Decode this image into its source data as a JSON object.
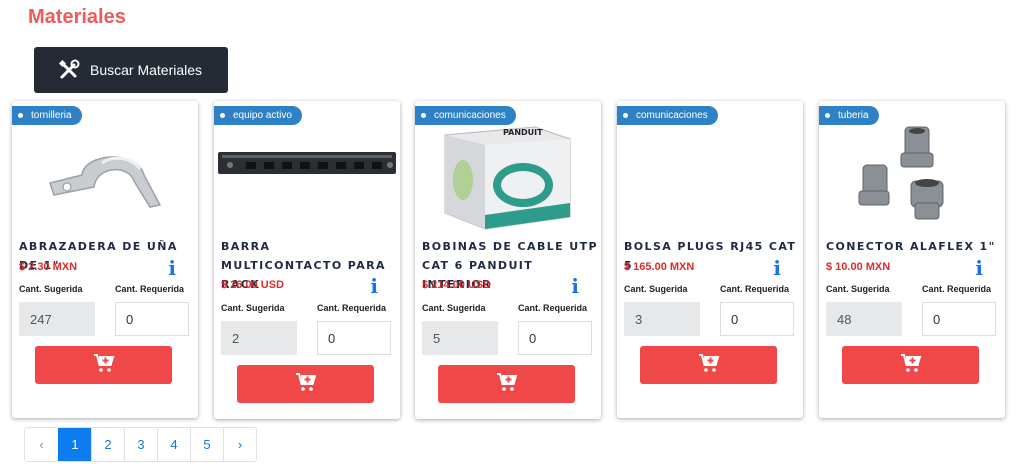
{
  "page": {
    "title": "Materiales"
  },
  "search": {
    "label": "Buscar Materiales"
  },
  "labels": {
    "suggested": "Cant. Sugerida",
    "required": "Cant. Requerida"
  },
  "products": [
    {
      "tag": "tornilleria",
      "name": "ABRAZADERA DE UÑA DE 1\"",
      "price": "$ 2.30 MXN",
      "suggested": "247",
      "required": "0"
    },
    {
      "tag": "equipo activo",
      "name": "BARRA MULTICONTACTO PARA RACK",
      "price": "$ 26.00 USD",
      "suggested": "2",
      "required": "0"
    },
    {
      "tag": "comunicaciones",
      "name": "BOBINAS DE CABLE UTP CAT 6 PANDUIT INTERIOR",
      "price": "$ 214.00 USD",
      "suggested": "5",
      "required": "0"
    },
    {
      "tag": "comunicaciones",
      "name": "BOLSA PLUGS RJ45 CAT 5",
      "price": "$ 165.00 MXN",
      "suggested": "3",
      "required": "0"
    },
    {
      "tag": "tuberia",
      "name": "CONECTOR ALAFLEX 1\"",
      "price": "$ 10.00 MXN",
      "suggested": "48",
      "required": "0"
    }
  ],
  "info_glyph": "i",
  "box_brand": "PANDUIT",
  "pagination": {
    "prev": "‹",
    "pages": [
      "1",
      "2",
      "3",
      "4",
      "5"
    ],
    "next": "›",
    "active": "1"
  },
  "colors": {
    "title": "#f15a5a",
    "cart": "#f04848",
    "badge": "#2f81c6",
    "price": "#e02b2b"
  }
}
